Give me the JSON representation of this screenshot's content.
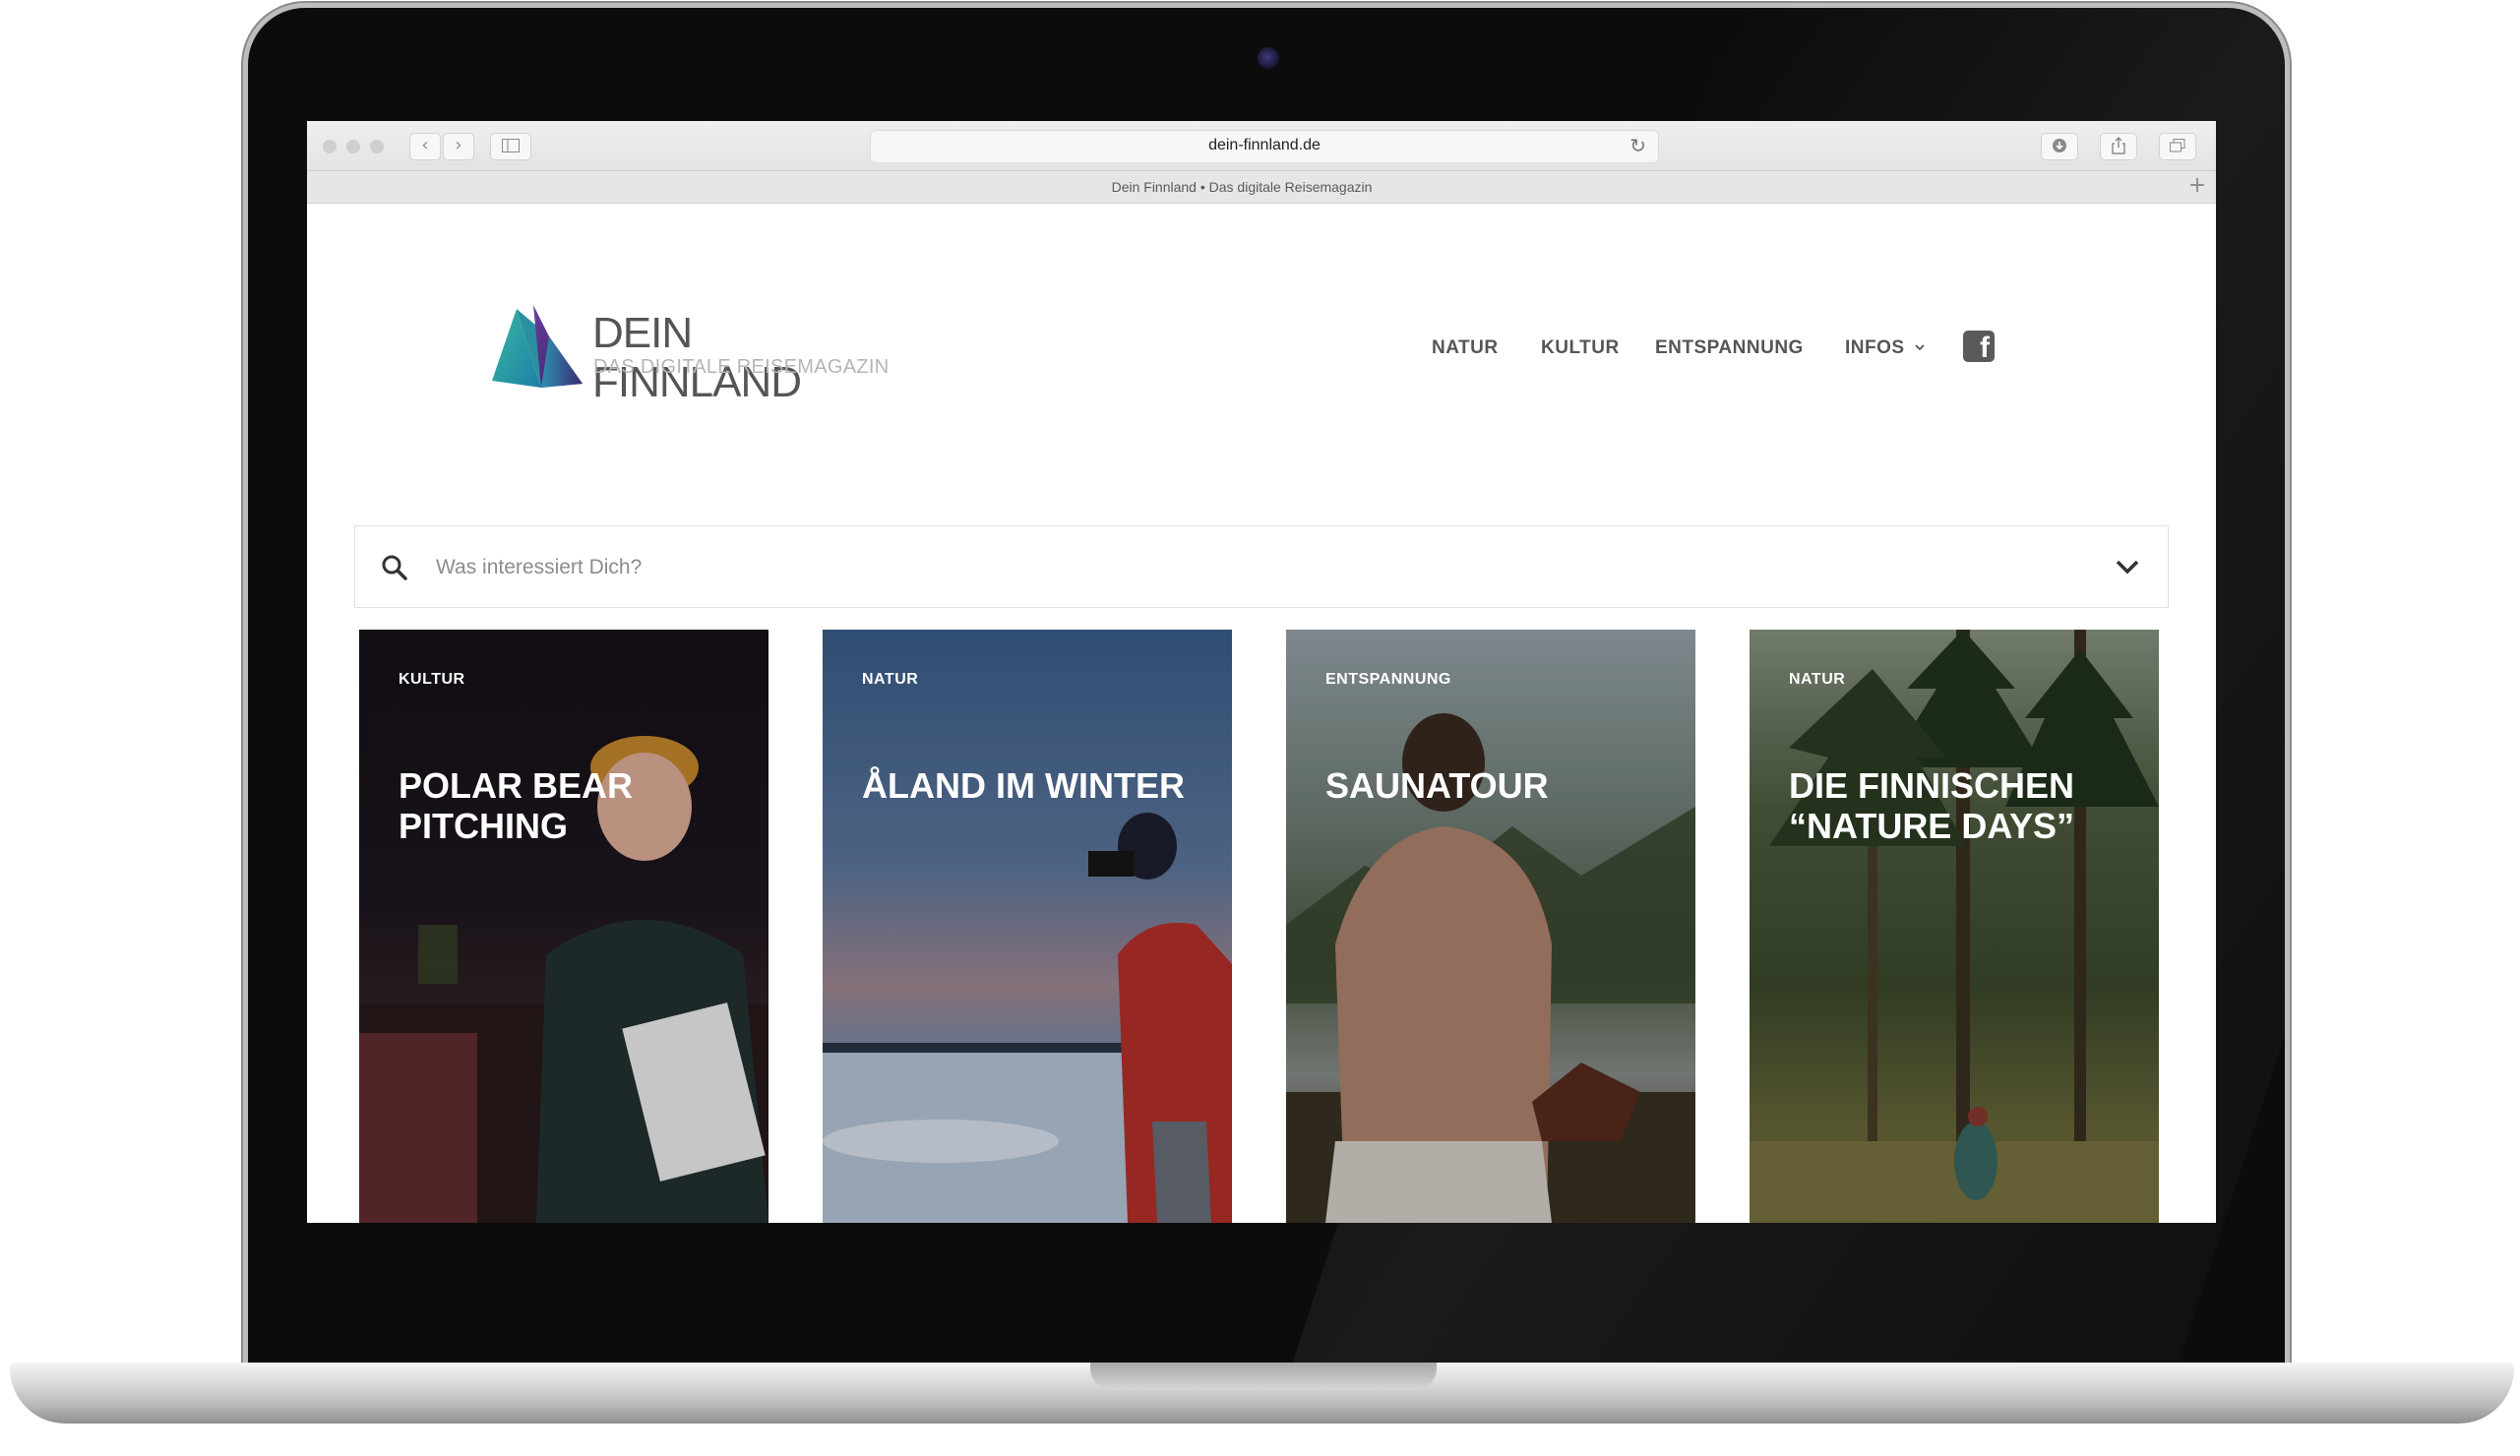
{
  "browser": {
    "url": "dein-finnland.de",
    "tab_title": "Dein Finnland • Das digitale Reisemagazin"
  },
  "site": {
    "logo_title": "DEIN FINNLAND",
    "logo_subtitle": "DAS DIGITALE REISEMAGAZIN",
    "nav": [
      "NATUR",
      "KULTUR",
      "ENTSPANNUNG",
      "INFOS"
    ],
    "search_placeholder": "Was interessiert Dich?",
    "cards": [
      {
        "category": "KULTUR",
        "title": "POLAR BEAR PITCHING"
      },
      {
        "category": "NATUR",
        "title": "ÅLAND IM WINTER"
      },
      {
        "category": "ENTSPANNUNG",
        "title": "SAUNATOUR"
      },
      {
        "category": "NATUR",
        "title": "DIE FINNISCHEN “NATURE DAYS”"
      }
    ]
  },
  "colors": {
    "nav_text": "#555555",
    "logo_teal": "#2ba6a8",
    "logo_purple": "#4b2f7a"
  }
}
